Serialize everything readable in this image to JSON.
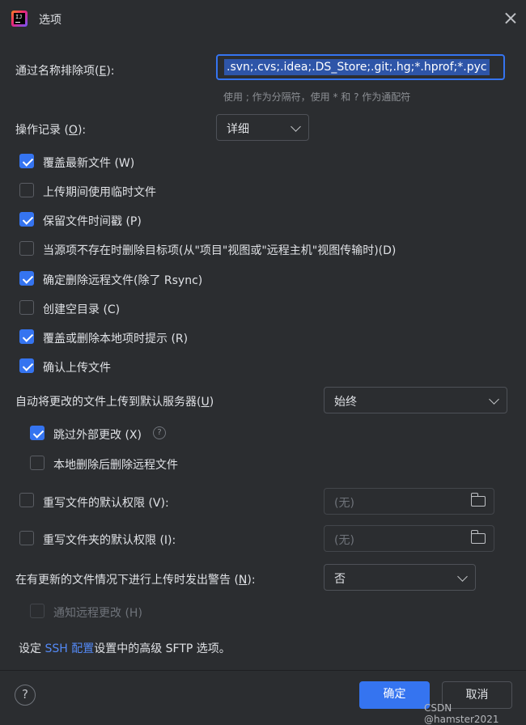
{
  "window": {
    "title": "选项",
    "app_icon": "intellij-icon",
    "app_icon_text": "IJ"
  },
  "exclude": {
    "label_prefix": "通过名称排除项(",
    "label_key": "E",
    "label_suffix": "):",
    "value": ".svn;.cvs;.idea;.DS_Store;.git;.hg;*.hprof;*.pyc",
    "hint": "使用 ; 作为分隔符，使用 * 和 ? 作为通配符"
  },
  "operation_log": {
    "label_prefix": "操作记录 (",
    "label_key": "O",
    "label_suffix": "):",
    "value": "详细"
  },
  "checkboxes": [
    {
      "label": "覆盖最新文件 (W)",
      "checked": true
    },
    {
      "label": "上传期间使用临时文件",
      "checked": false
    },
    {
      "label": "保留文件时间戳 (P)",
      "checked": true
    },
    {
      "label": "当源项不存在时删除目标项(从\"项目\"视图或\"远程主机\"视图传输时)(D)",
      "checked": false
    },
    {
      "label": "确定删除远程文件(除了 Rsync)",
      "checked": true
    },
    {
      "label": "创建空目录 (C)",
      "checked": false
    },
    {
      "label": "覆盖或删除本地项时提示 (R)",
      "checked": true
    },
    {
      "label": "确认上传文件",
      "checked": true
    }
  ],
  "auto_upload": {
    "label_prefix": "自动将更改的文件上传到默认服务器(",
    "label_key": "U",
    "label_suffix": ")",
    "value": "始终"
  },
  "sub_checkboxes": [
    {
      "label": "跳过外部更改 (X)",
      "checked": true
    },
    {
      "label": "本地删除后删除远程文件",
      "checked": false
    }
  ],
  "permissions": [
    {
      "label": "重写文件的默认权限 (V):",
      "checked": false,
      "placeholder": "(无)"
    },
    {
      "label": "重写文件夹的默认权限 (I):",
      "checked": false,
      "placeholder": "(无)"
    }
  ],
  "warn": {
    "label_prefix": "在有更新的文件情况下进行上传时发出警告 (",
    "label_key": "N",
    "label_suffix": "):",
    "value": "否"
  },
  "notify_remote": {
    "label": "通知远程更改 (H)",
    "checked": false,
    "disabled": true
  },
  "ssh_note": {
    "prefix": "设定 ",
    "link": "SSH 配置",
    "suffix": "设置中的高级 SFTP 选项。"
  },
  "footer": {
    "help": "?",
    "ok": "确定",
    "cancel": "取消"
  },
  "watermark": "CSDN @hamster2021",
  "colors": {
    "accent": "#3574f0",
    "background": "#2b2d30",
    "text": "#dfe1e5",
    "link": "#548af7"
  }
}
